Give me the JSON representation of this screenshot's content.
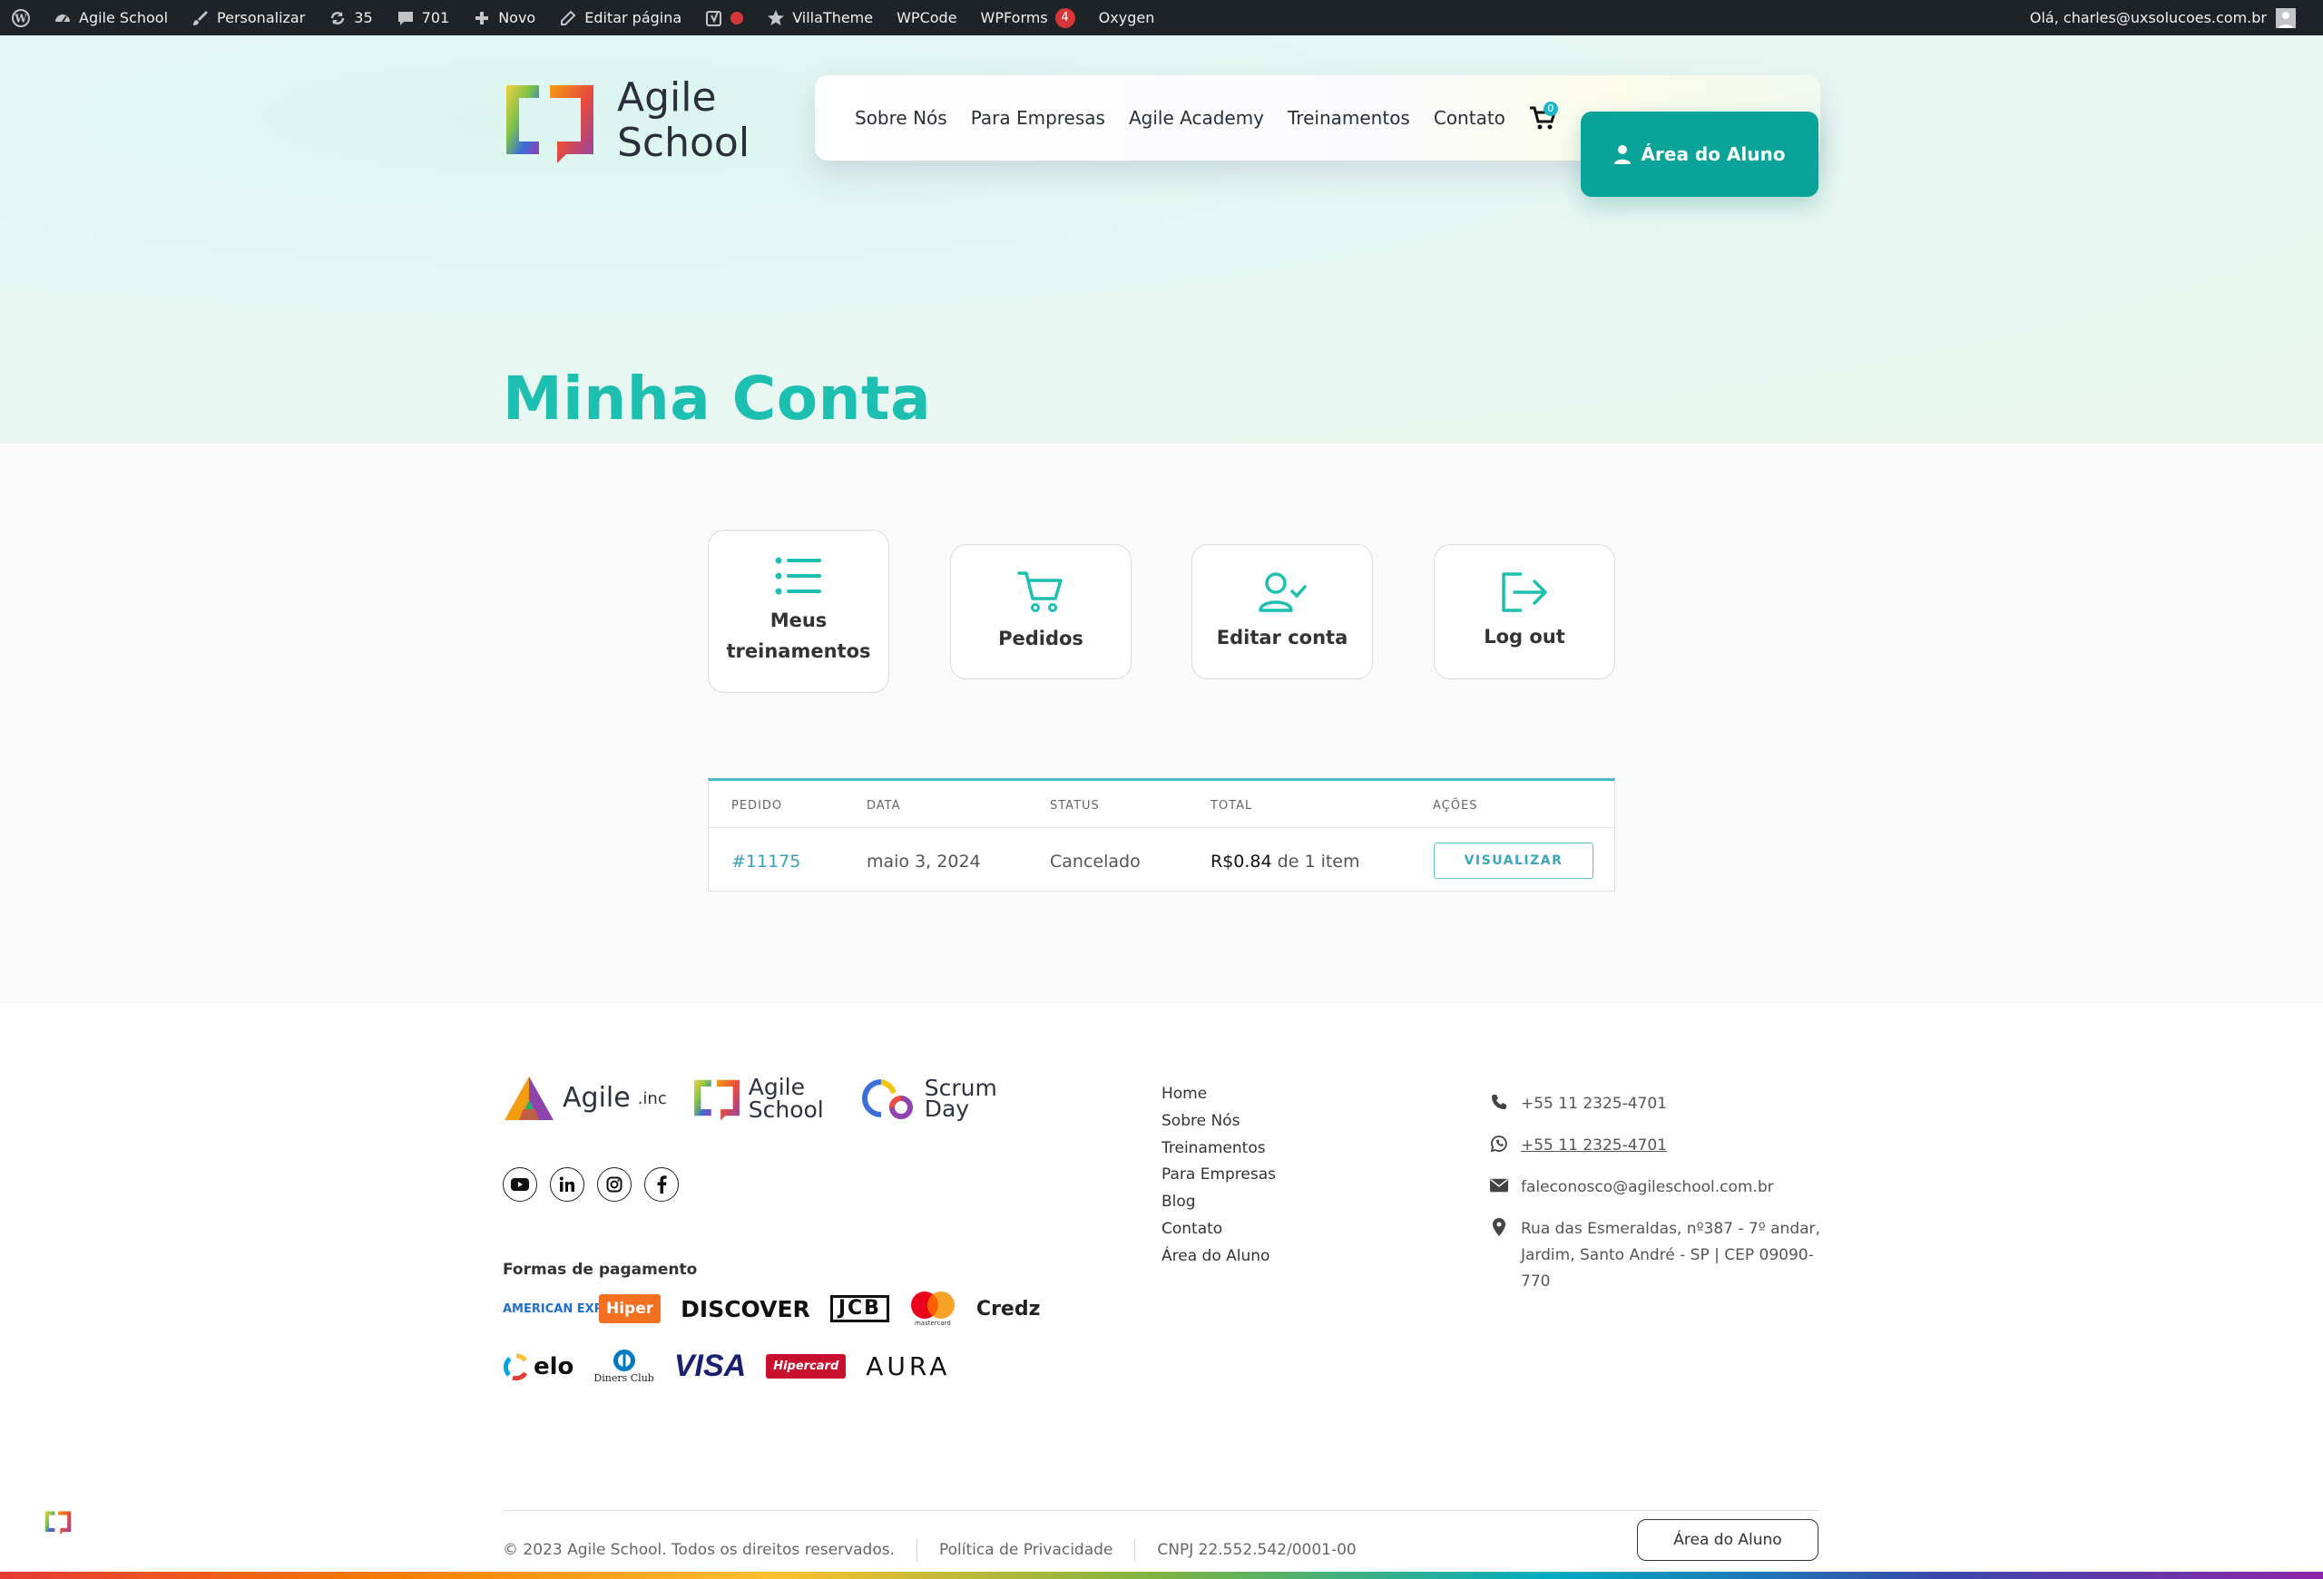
{
  "adminbar": {
    "site": "Agile School",
    "customize": "Personalizar",
    "updates": "35",
    "comments": "701",
    "new": "Novo",
    "edit": "Editar página",
    "villatheme": "VillaTheme",
    "wpcode": "WPCode",
    "wpforms": "WPForms",
    "wpforms_count": "4",
    "oxygen": "Oxygen",
    "greeting": "Olá, charles@uxsolucoes.com.br"
  },
  "header": {
    "logo_line1": "Agile",
    "logo_line2": "School",
    "nav": [
      "Sobre Nós",
      "Para Empresas",
      "Agile Academy",
      "Treinamentos",
      "Contato"
    ],
    "cart_count": "0",
    "student_button": "Área do Aluno"
  },
  "page_title": "Minha Conta",
  "account_menu": [
    {
      "label": "Meus treinamentos",
      "icon": "list-icon"
    },
    {
      "label": "Pedidos",
      "icon": "cart-icon"
    },
    {
      "label": "Editar conta",
      "icon": "user-check-icon"
    },
    {
      "label": "Log out",
      "icon": "logout-icon"
    }
  ],
  "orders": {
    "headers": [
      "PEDIDO",
      "DATA",
      "STATUS",
      "TOTAL",
      "AÇÕES"
    ],
    "rows": [
      {
        "order": "#11175",
        "date": "maio 3, 2024",
        "status": "Cancelado",
        "amount": "R$0.84",
        "items": "de 1 item",
        "action": "VISUALIZAR"
      }
    ]
  },
  "footer": {
    "brands": [
      {
        "name": "Agile",
        "suffix": ".inc"
      },
      {
        "name": "Agile School"
      },
      {
        "name": "Scrum Day"
      }
    ],
    "social": [
      "youtube-icon",
      "linkedin-icon",
      "instagram-icon",
      "facebook-icon"
    ],
    "payments_title": "Formas de pagamento",
    "payments_row1": [
      "AMERICAN EXPRESS",
      "Hiper",
      "DISCOVER",
      "JCB",
      "mastercard",
      "Credz"
    ],
    "payments_row2": [
      "elo",
      "Diners Club",
      "VISA",
      "Hipercard",
      "AURA"
    ],
    "links": [
      "Home",
      "Sobre Nós",
      "Treinamentos",
      "Para Empresas",
      "Blog",
      "Contato",
      "Área do Aluno"
    ],
    "phone": "+55 11 2325-4701",
    "whatsapp": "+55 11 2325-4701",
    "email": "faleconosco@agileschool.com.br",
    "address": "Rua das Esmeraldas, nº387 - 7º andar, Jardim, Santo André - SP | CEP 09090-770",
    "copyright": "© 2023 Agile School. Todos os direitos reservados.",
    "privacy": "Política de Privacidade",
    "cnpj": "CNPJ 22.552.542/0001-00",
    "student_button": "Área do Aluno"
  },
  "colors": {
    "accent": "#0aa39a",
    "title": "#1dbfb0",
    "link": "#3a9fb7",
    "adminbar": "#1d2327"
  }
}
